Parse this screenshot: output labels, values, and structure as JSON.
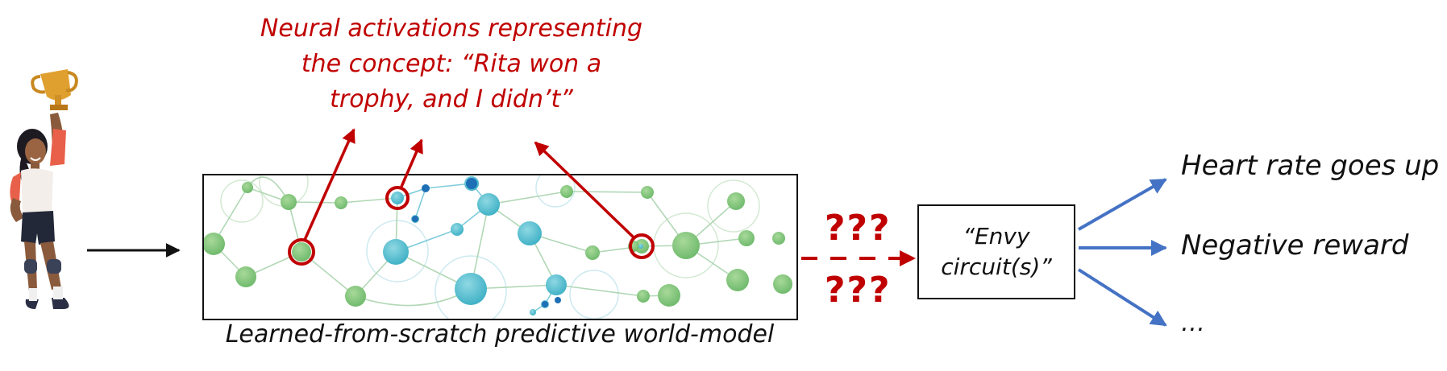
{
  "concept_label": {
    "line1": "Neural activations representing",
    "line2": "the concept: “Rita won a",
    "line3": "trophy, and I didn’t”"
  },
  "model_caption": "Learned-from-scratch predictive world-model",
  "unknown_link": {
    "top": "???",
    "bottom": "???"
  },
  "envy_box": {
    "line1": "“Envy",
    "line2": "circuit(s)”"
  },
  "outputs": [
    "Heart rate goes up",
    "Negative reward",
    "…"
  ],
  "colors": {
    "red": "#C00000",
    "blue": "#4472C4",
    "black": "#111111",
    "node_green": "#7DC27A",
    "node_teal": "#4DB8C8",
    "node_blue": "#1E6FB5"
  },
  "icons": [
    "woman-holding-trophy-illustration"
  ]
}
